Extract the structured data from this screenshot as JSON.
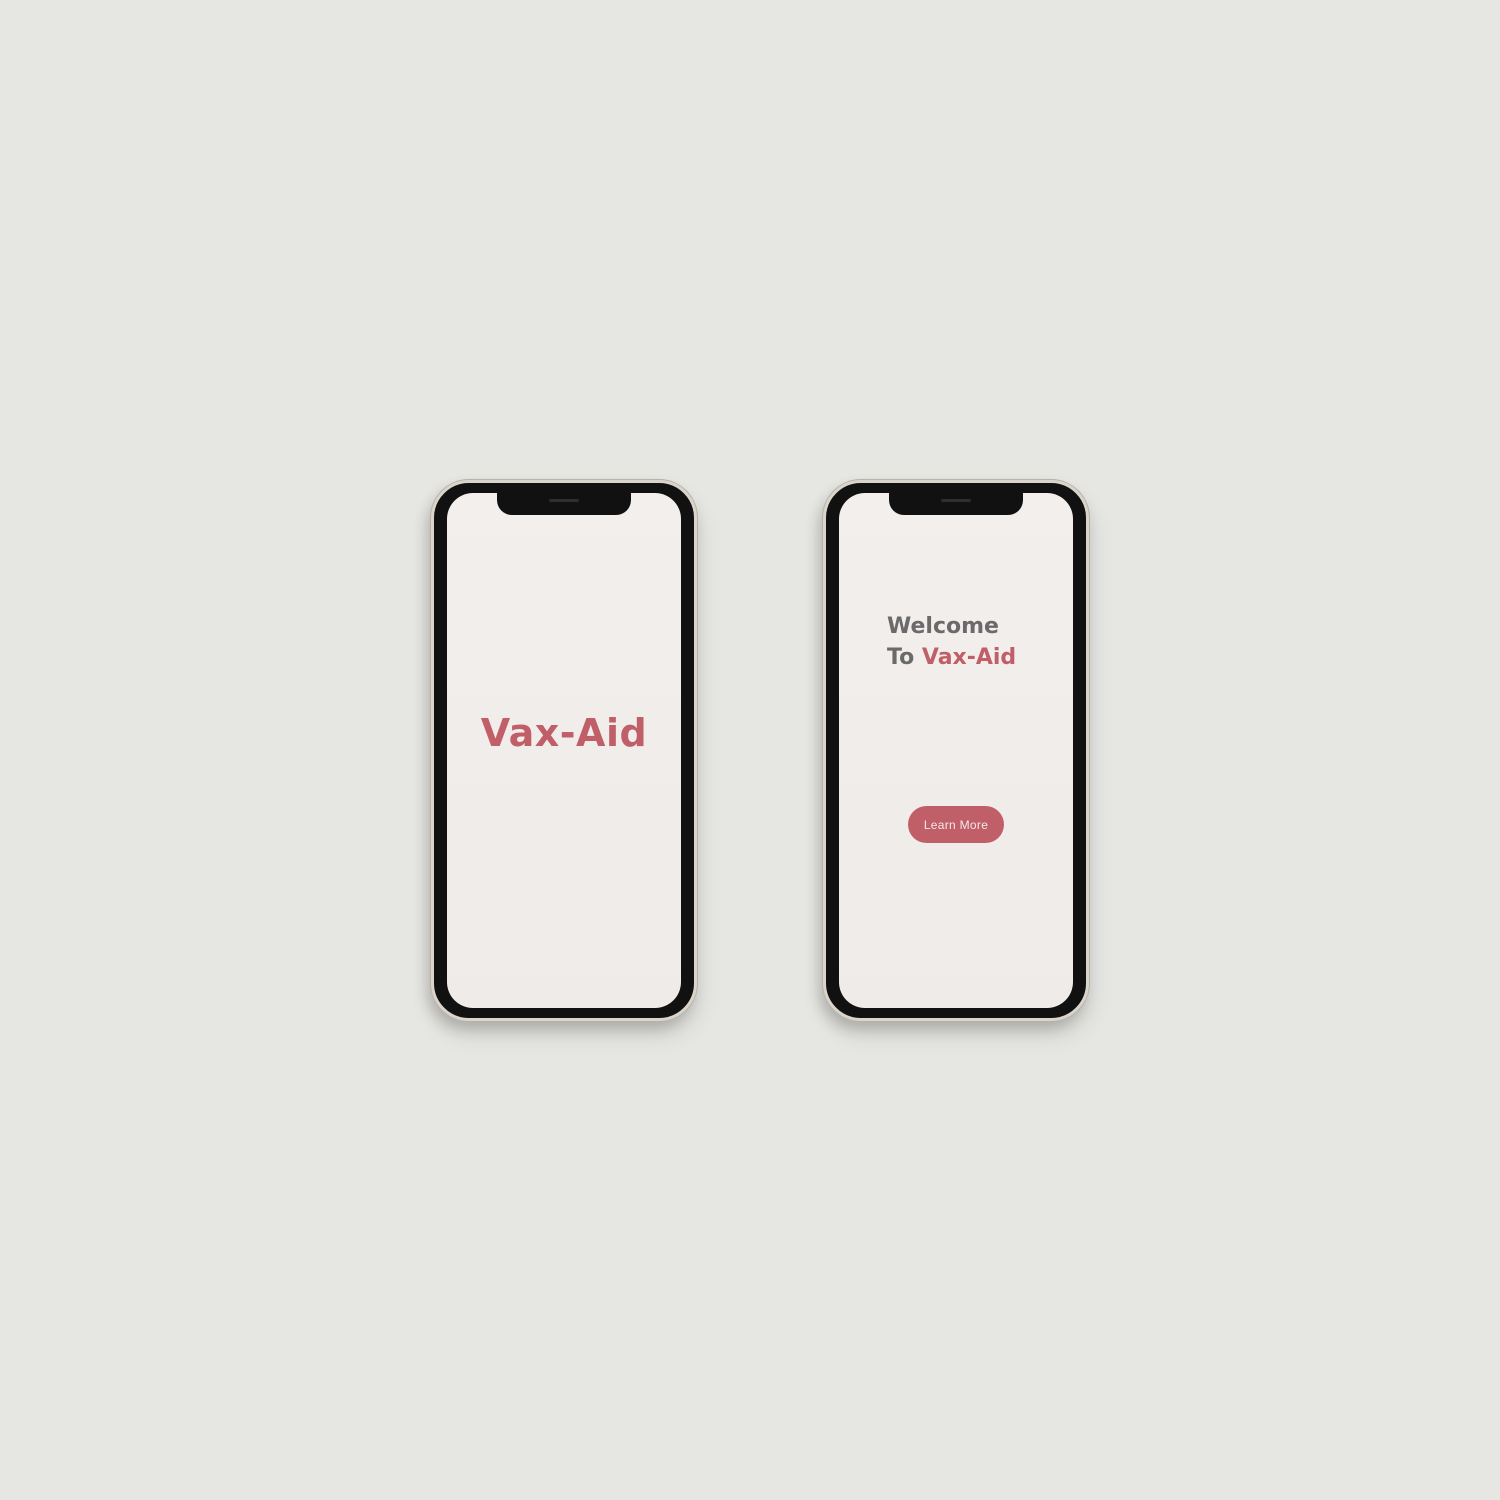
{
  "screens": [
    {
      "id": "splash",
      "title": "Vax-Aid"
    },
    {
      "id": "welcome",
      "heading_line1": "Welcome",
      "heading_line2_prefix": "To",
      "heading_line2_brand": "Vax-Aid",
      "button_label": "Learn More"
    }
  ],
  "colors": {
    "background": "#e6e6e3",
    "screen": "#f0edeb",
    "brand": "#c15f68",
    "heading_gray": "#6a6a6a",
    "button_text": "#f4e9ea"
  }
}
